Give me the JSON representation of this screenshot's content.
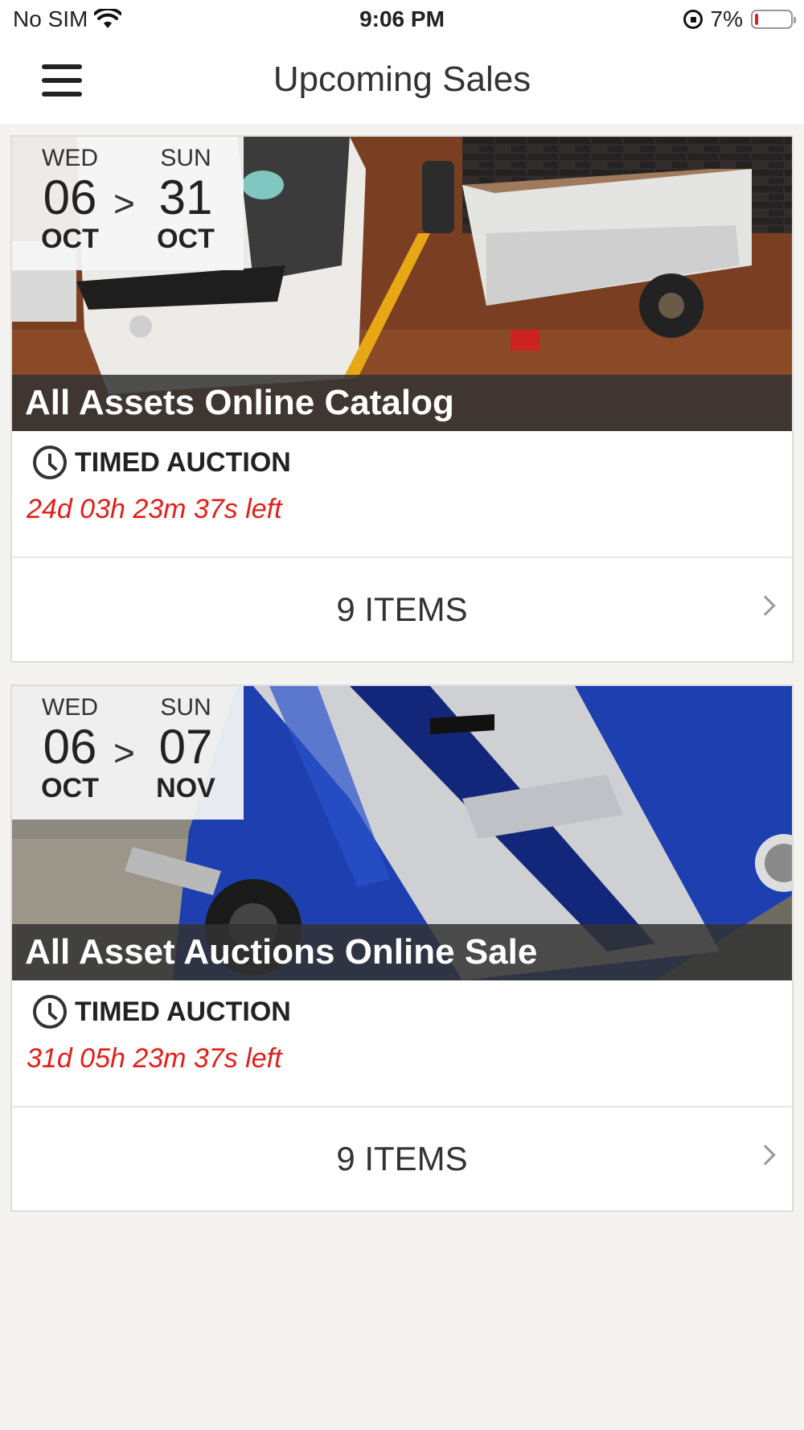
{
  "status": {
    "carrier": "No SIM",
    "time": "9:06 PM",
    "battery": "7%"
  },
  "nav": {
    "title": "Upcoming Sales"
  },
  "sales": [
    {
      "start_dow": "WED",
      "start_day": "06",
      "start_month": "OCT",
      "separator": ">",
      "end_dow": "SUN",
      "end_day": "31",
      "end_month": "OCT",
      "title": "All Assets Online Catalog",
      "auction_type": "TIMED AUCTION",
      "time_left": "24d 03h 23m 37s left",
      "items": "9 ITEMS"
    },
    {
      "start_dow": "WED",
      "start_day": "06",
      "start_month": "OCT",
      "separator": ">",
      "end_dow": "SUN",
      "end_day": "07",
      "end_month": "NOV",
      "title": "All Asset Auctions Online Sale",
      "auction_type": "TIMED AUCTION",
      "time_left": "31d 05h 23m 37s left",
      "items": "9 ITEMS"
    }
  ],
  "colors": {
    "background": "#f4f3f0",
    "countdown": "#e0201a",
    "title_band": "#323232"
  }
}
